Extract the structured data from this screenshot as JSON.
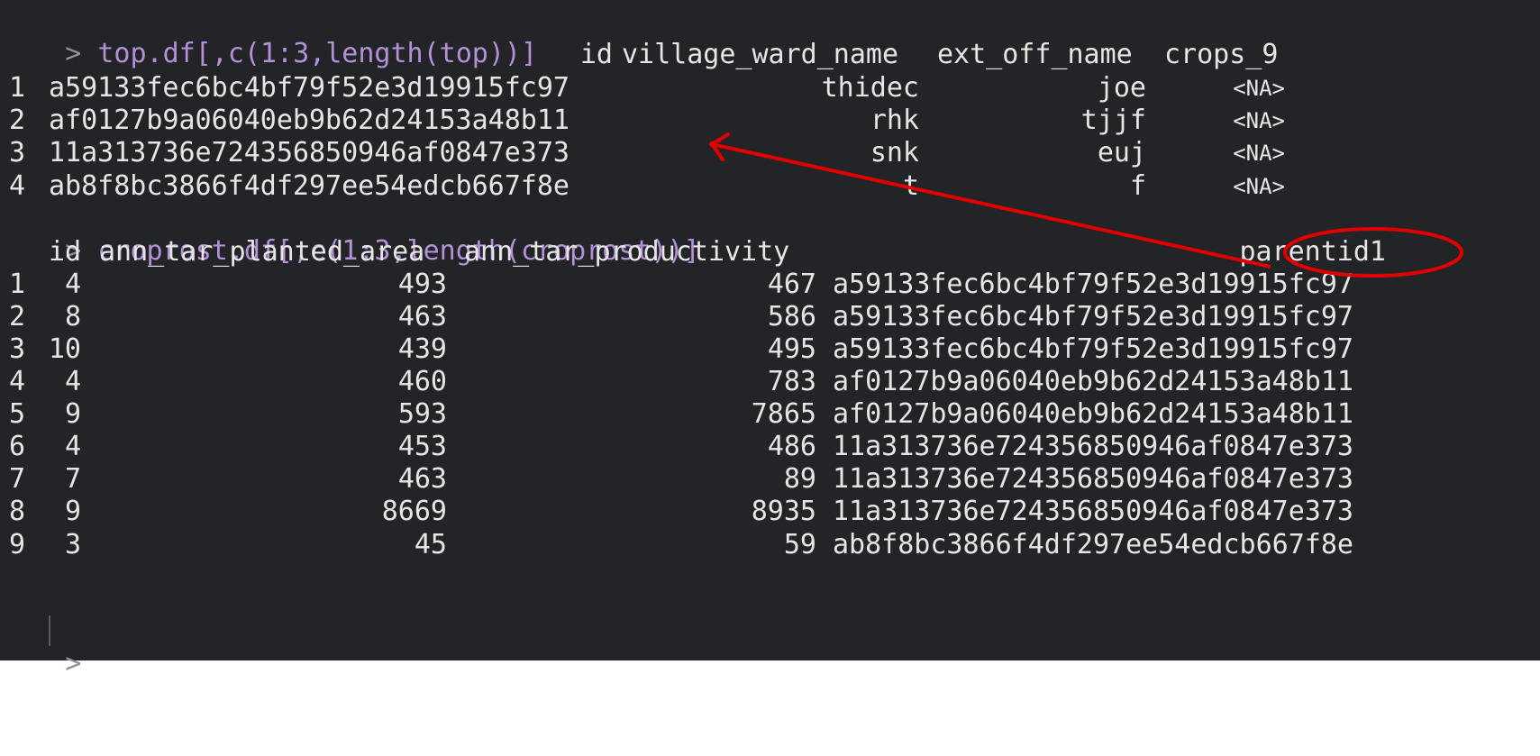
{
  "console": {
    "prompt": ">",
    "commands": [
      {
        "text": " top.df[,c(1:3,length(top))]"
      },
      {
        "text": " croprost.df[,c(1:3,length(croprost))]"
      }
    ],
    "top_table": {
      "headers": [
        "id",
        "village_ward_name",
        "ext_off_name",
        "crops_9"
      ],
      "rows": [
        {
          "n": "1",
          "id": "a59133fec6bc4bf79f52e3d19915fc97",
          "village": "thidec",
          "ext": "joe",
          "crops": "<NA>"
        },
        {
          "n": "2",
          "id": "af0127b9a06040eb9b62d24153a48b11",
          "village": "rhk",
          "ext": "tjjf",
          "crops": "<NA>"
        },
        {
          "n": "3",
          "id": "11a313736e724356850946af0847e373",
          "village": "snk",
          "ext": "euj",
          "crops": "<NA>"
        },
        {
          "n": "4",
          "id": "ab8f8bc3866f4df297ee54edcb667f8e",
          "village": "t",
          "ext": "f",
          "crops": "<NA>"
        }
      ]
    },
    "croprost_table": {
      "headers": [
        "id",
        "ann_tar_planted_area",
        "ann_tar_productivity",
        "parentid1"
      ],
      "rows": [
        {
          "n": "1",
          "id": "4",
          "area": "493",
          "prod": "467",
          "parent": "a59133fec6bc4bf79f52e3d19915fc97"
        },
        {
          "n": "2",
          "id": "8",
          "area": "463",
          "prod": "586",
          "parent": "a59133fec6bc4bf79f52e3d19915fc97"
        },
        {
          "n": "3",
          "id": "10",
          "area": "439",
          "prod": "495",
          "parent": "a59133fec6bc4bf79f52e3d19915fc97"
        },
        {
          "n": "4",
          "id": "4",
          "area": "460",
          "prod": "783",
          "parent": "af0127b9a06040eb9b62d24153a48b11"
        },
        {
          "n": "5",
          "id": "9",
          "area": "593",
          "prod": "7865",
          "parent": "af0127b9a06040eb9b62d24153a48b11"
        },
        {
          "n": "6",
          "id": "4",
          "area": "453",
          "prod": "486",
          "parent": "11a313736e724356850946af0847e373"
        },
        {
          "n": "7",
          "id": "7",
          "area": "463",
          "prod": "89",
          "parent": "11a313736e724356850946af0847e373"
        },
        {
          "n": "8",
          "id": "9",
          "area": "8669",
          "prod": "8935",
          "parent": "11a313736e724356850946af0847e373"
        },
        {
          "n": "9",
          "id": "3",
          "area": "45",
          "prod": "59",
          "parent": "ab8f8bc3866f4df297ee54edcb667f8e"
        }
      ]
    }
  },
  "colors": {
    "background": "#232427",
    "text": "#e6e6e6",
    "command": "#b490d8",
    "prompt": "#8f8f9f",
    "annotation": "#e00000"
  }
}
